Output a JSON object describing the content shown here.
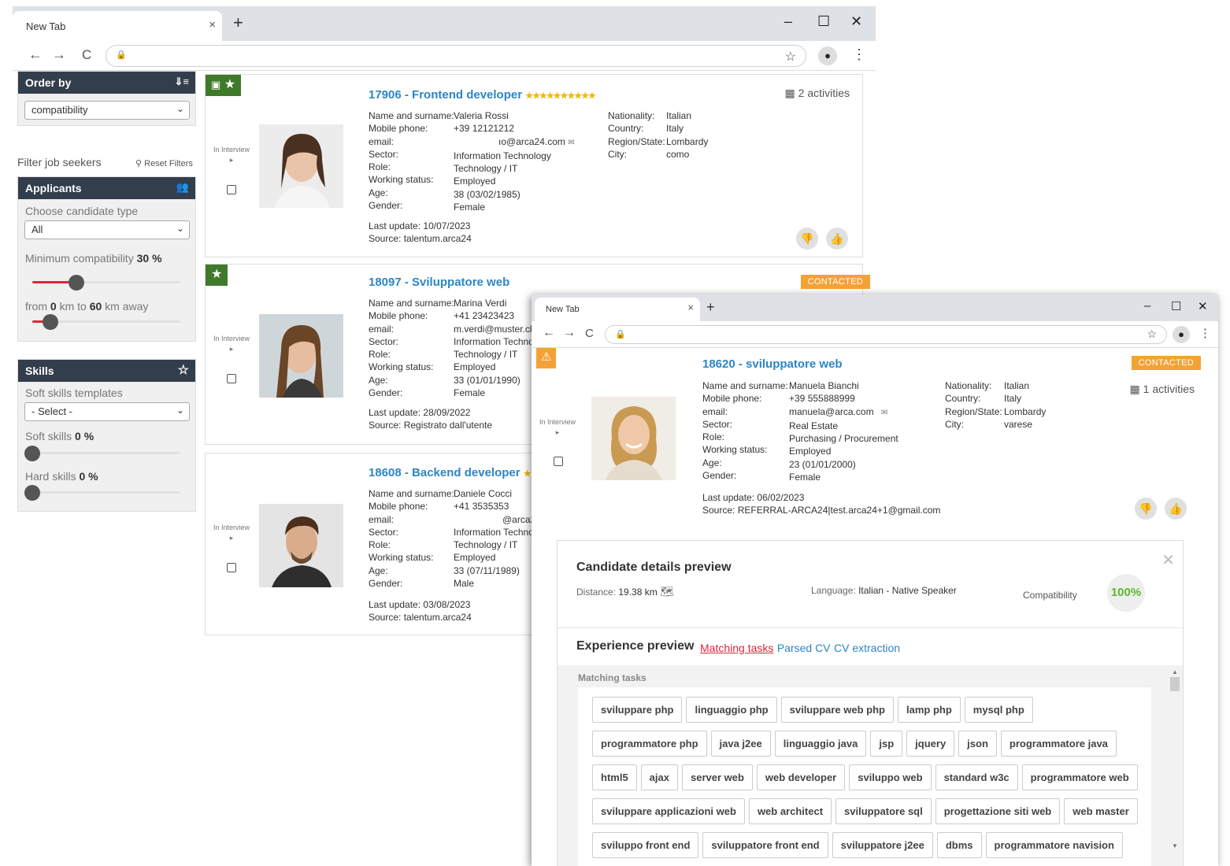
{
  "browser": {
    "tab_title": "New Tab",
    "tab_close": "×",
    "new_tab": "+",
    "minimize": "–",
    "maximize": "☐",
    "close": "✕",
    "back": "←",
    "forward": "→",
    "reload": "C",
    "lock": "🔒",
    "bookmark": "☆",
    "menu": "⋮"
  },
  "sidebar": {
    "order_by_title": "Order by",
    "order_by_value": "compatibility",
    "filter_label": "Filter job seekers",
    "reset_filters": "Reset Filters",
    "applicants_title": "Applicants",
    "candidate_type_label": "Choose candidate type",
    "candidate_type_value": "All",
    "min_compat_label": "Minimum compatibility",
    "min_compat_value": "30",
    "min_compat_unit": "%",
    "distance_from_label": "from",
    "distance_from": "0",
    "distance_to_label": "km to",
    "distance_to": "60",
    "distance_suffix": "km away",
    "min_compat_fraction": 0.3,
    "distance_fraction": 0.12,
    "skills_title": "Skills",
    "soft_templates_label": "Soft skills templates",
    "soft_templates_value": "- Select -",
    "soft_skills_label": "Soft skills",
    "soft_skills_value": "0",
    "hard_skills_label": "Hard skills",
    "hard_skills_value": "0",
    "pct": "%"
  },
  "labels": {
    "in_interview": "In Interview",
    "name": "Name and surname:",
    "mobile": "Mobile phone:",
    "email": "email:",
    "sector": "Sector:",
    "role": "Role:",
    "working": "Working status:",
    "age": "Age:",
    "gender": "Gender:",
    "last_update": "Last update:",
    "source": "Source:",
    "nationality": "Nationality:",
    "country": "Country:",
    "region": "Region/State:",
    "city": "City:",
    "contacted": "CONTACTED"
  },
  "cards": [
    {
      "title": "17906 - Frontend developer",
      "stars": "★★★★★★★★★★",
      "activities": "2 activities",
      "name": "Valeria Rossi",
      "mobile": "+39 12121212",
      "email": "ıo@arca24.com",
      "sector": "Information Technology",
      "role": "Technology / IT",
      "working": "Employed",
      "age": "38 (03/02/1985)",
      "gender": "Female",
      "last_update": "10/07/2023",
      "source": "talentum.arca24",
      "nationality": "Italian",
      "country": "Italy",
      "region": "Lombardy",
      "city": "como"
    },
    {
      "title": "18097 - Sviluppatore web",
      "name": "Marina Verdi",
      "mobile": "+41 23423423",
      "email": "m.verdi@muster.ch",
      "sector": "Information Techno",
      "role": "Technology / IT",
      "working": "Employed",
      "age": "33 (01/01/1990)",
      "gender": "Female",
      "last_update": "28/09/2022",
      "source": "Registrato dall'utente"
    },
    {
      "title": "18608 - Backend developer",
      "name": "Daniele Cocci",
      "mobile": "+41 3535353",
      "email": "@arca2",
      "sector": "Information Techno",
      "role": "Technology / IT",
      "working": "Employed",
      "age": "33 (07/11/1989)",
      "gender": "Male",
      "last_update": "03/08/2023",
      "source": "talentum.arca24"
    }
  ],
  "detail": {
    "title": "18620 - sviluppatore web",
    "activities": "1 activities",
    "name": "Manuela Bianchi",
    "mobile": "+39 555888999",
    "email": "manuela@arca.com",
    "sector": "Real Estate",
    "role": "Purchasing / Procurement",
    "working": "Employed",
    "age": "23 (01/01/2000)",
    "gender": "Female",
    "last_update": "06/02/2023",
    "source": "REFERRAL-ARCA24|test.arca24+1@gmail.com",
    "nationality": "Italian",
    "country": "Italy",
    "region": "Lombardy",
    "city": "varese"
  },
  "preview": {
    "title": "Candidate details preview",
    "close": "✕",
    "distance_label": "Distance:",
    "distance_value": "19.38 km",
    "language_label": "Language:",
    "language_value": "Italian - Native Speaker",
    "compat_label": "Compatibility",
    "compat_value": "100%",
    "exp_title": "Experience preview",
    "tab_matching": "Matching tasks",
    "tab_parsed": "Parsed CV",
    "tab_extraction": "CV extraction",
    "section_label": "Matching tasks",
    "tasks": [
      "sviluppare php",
      "linguaggio php",
      "sviluppare web php",
      "lamp php",
      "mysql php",
      "programmatore php",
      "java j2ee",
      "linguaggio java",
      "jsp",
      "jquery",
      "json",
      "programmatore java",
      "html5",
      "ajax",
      "server web",
      "web developer",
      "sviluppo web",
      "standard w3c",
      "programmatore web",
      "sviluppare applicazioni web",
      "web architect",
      "sviluppatore sql",
      "progettazione siti web",
      "web master",
      "sviluppo front end",
      "sviluppatore front end",
      "sviluppatore j2ee",
      "dbms",
      "programmatore navision"
    ]
  },
  "colors": {
    "header_dark": "#333e4d",
    "link_blue": "#2b86c4",
    "badge_green": "#3f7a2b",
    "contacted_orange": "#f4a236",
    "slider_red": "#e0263a",
    "compat_green": "#5cb82a"
  }
}
